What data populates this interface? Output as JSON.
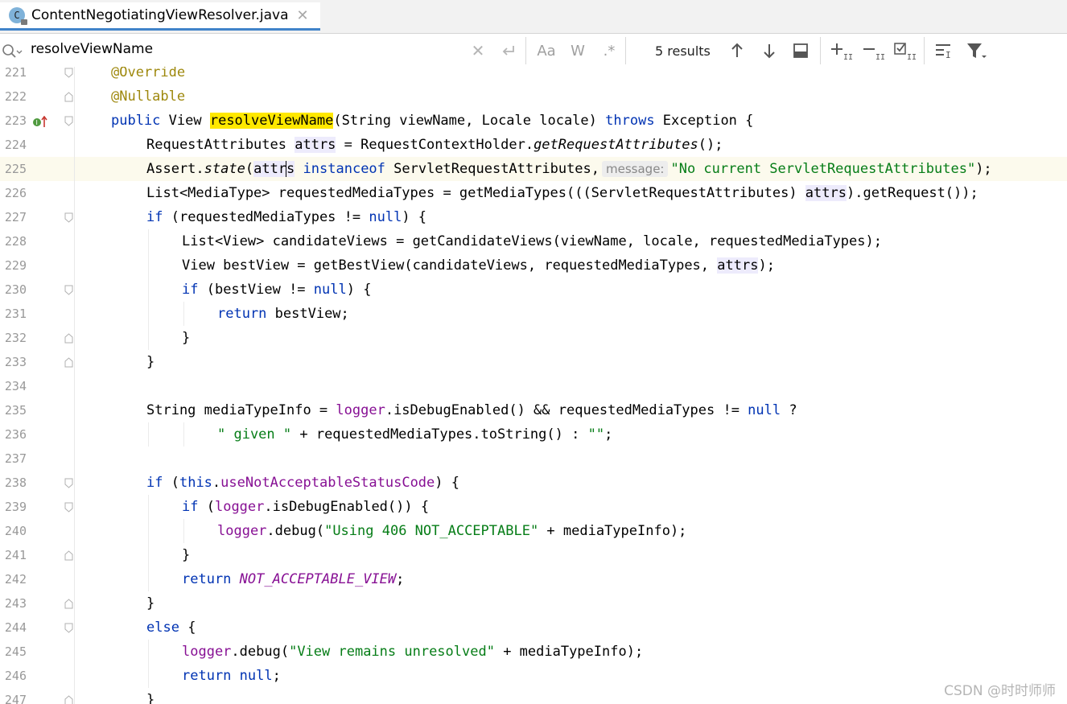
{
  "editor_tab": {
    "icon_letter": "C",
    "file_name": "ContentNegotiatingViewResolver.java",
    "close_glyph": "✕"
  },
  "search": {
    "query": "resolveViewName",
    "results_label": "5 results"
  },
  "toolbar": {
    "match_case_label": "Aa",
    "whole_words_label": "W",
    "regex_label": ".*"
  },
  "lines": [
    {
      "num": "221",
      "indent": 0,
      "tokens": [
        {
          "t": "@Override",
          "c": "ann"
        }
      ]
    },
    {
      "num": "222",
      "indent": 0,
      "tokens": [
        {
          "t": "@Nullable",
          "c": "ann"
        }
      ]
    },
    {
      "num": "223",
      "indent": 0,
      "tokens": [
        {
          "t": "public",
          "c": "kw"
        },
        {
          "t": " View "
        },
        {
          "t": "resolveViewName",
          "c": "match"
        },
        {
          "t": "(String viewName, Locale locale) "
        },
        {
          "t": "throws",
          "c": "kw"
        },
        {
          "t": " Exception {"
        }
      ]
    },
    {
      "num": "224",
      "indent": 1,
      "tokens": [
        {
          "t": "RequestAttributes "
        },
        {
          "t": "attrs",
          "c": "usage"
        },
        {
          "t": " = RequestContextHolder."
        },
        {
          "t": "getRequestAttributes",
          "c": "it"
        },
        {
          "t": "();"
        }
      ]
    },
    {
      "num": "225",
      "indent": 1,
      "current": true,
      "tokens": [
        {
          "t": "Assert."
        },
        {
          "t": "state",
          "c": "it"
        },
        {
          "t": "("
        },
        {
          "t": "attr",
          "c": "usage"
        },
        {
          "caret": true
        },
        {
          "t": "s",
          "c": "usage"
        },
        {
          "t": " "
        },
        {
          "t": "instanceof",
          "c": "kw"
        },
        {
          "t": " ServletRequestAttributes,"
        },
        {
          "t": "message:",
          "c": "hint"
        },
        {
          "t": "\"No current ServletRequestAttributes\"",
          "c": "str"
        },
        {
          "t": ");"
        }
      ]
    },
    {
      "num": "226",
      "indent": 1,
      "tokens": [
        {
          "t": "List<MediaType> requestedMediaTypes = getMediaTypes(((ServletRequestAttributes) "
        },
        {
          "t": "attrs",
          "c": "usage"
        },
        {
          "t": ").getRequest());"
        }
      ]
    },
    {
      "num": "227",
      "indent": 1,
      "tokens": [
        {
          "t": "if",
          "c": "kw"
        },
        {
          "t": " (requestedMediaTypes != "
        },
        {
          "t": "null",
          "c": "kw"
        },
        {
          "t": ") {"
        }
      ]
    },
    {
      "num": "228",
      "indent": 2,
      "tokens": [
        {
          "t": "List<View> candidateViews = getCandidateViews(viewName, locale, requestedMediaTypes);"
        }
      ]
    },
    {
      "num": "229",
      "indent": 2,
      "tokens": [
        {
          "t": "View bestView = getBestView(candidateViews, requestedMediaTypes, "
        },
        {
          "t": "attrs",
          "c": "usage"
        },
        {
          "t": ");"
        }
      ]
    },
    {
      "num": "230",
      "indent": 2,
      "tokens": [
        {
          "t": "if",
          "c": "kw"
        },
        {
          "t": " (bestView != "
        },
        {
          "t": "null",
          "c": "kw"
        },
        {
          "t": ") {"
        }
      ]
    },
    {
      "num": "231",
      "indent": 3,
      "tokens": [
        {
          "t": "return",
          "c": "kw"
        },
        {
          "t": " bestView;"
        }
      ]
    },
    {
      "num": "232",
      "indent": 2,
      "tokens": [
        {
          "t": "}"
        }
      ]
    },
    {
      "num": "233",
      "indent": 1,
      "tokens": [
        {
          "t": "}"
        }
      ]
    },
    {
      "num": "234",
      "indent": 0,
      "tokens": []
    },
    {
      "num": "235",
      "indent": 1,
      "tokens": [
        {
          "t": "String mediaTypeInfo = "
        },
        {
          "t": "logger",
          "c": "fld"
        },
        {
          "t": ".isDebugEnabled() && requestedMediaTypes != "
        },
        {
          "t": "null",
          "c": "kw"
        },
        {
          "t": " ?"
        }
      ]
    },
    {
      "num": "236",
      "indent": 3,
      "tokens": [
        {
          "t": "\" given \"",
          "c": "str"
        },
        {
          "t": " + requestedMediaTypes.toString() : "
        },
        {
          "t": "\"\"",
          "c": "str"
        },
        {
          "t": ";"
        }
      ]
    },
    {
      "num": "237",
      "indent": 0,
      "tokens": []
    },
    {
      "num": "238",
      "indent": 1,
      "tokens": [
        {
          "t": "if",
          "c": "kw"
        },
        {
          "t": " ("
        },
        {
          "t": "this",
          "c": "kw"
        },
        {
          "t": "."
        },
        {
          "t": "useNotAcceptableStatusCode",
          "c": "fld"
        },
        {
          "t": ") {"
        }
      ]
    },
    {
      "num": "239",
      "indent": 2,
      "tokens": [
        {
          "t": "if",
          "c": "kw"
        },
        {
          "t": " ("
        },
        {
          "t": "logger",
          "c": "fld"
        },
        {
          "t": ".isDebugEnabled()) {"
        }
      ]
    },
    {
      "num": "240",
      "indent": 3,
      "tokens": [
        {
          "t": "logger",
          "c": "fld"
        },
        {
          "t": ".debug("
        },
        {
          "t": "\"Using 406 NOT_ACCEPTABLE\"",
          "c": "str"
        },
        {
          "t": " + mediaTypeInfo);"
        }
      ]
    },
    {
      "num": "241",
      "indent": 2,
      "tokens": [
        {
          "t": "}"
        }
      ]
    },
    {
      "num": "242",
      "indent": 2,
      "tokens": [
        {
          "t": "return",
          "c": "kw"
        },
        {
          "t": " "
        },
        {
          "t": "NOT_ACCEPTABLE_VIEW",
          "c": "fld it"
        },
        {
          "t": ";"
        }
      ]
    },
    {
      "num": "243",
      "indent": 1,
      "tokens": [
        {
          "t": "}"
        }
      ]
    },
    {
      "num": "244",
      "indent": 1,
      "tokens": [
        {
          "t": "else",
          "c": "kw"
        },
        {
          "t": " {"
        }
      ]
    },
    {
      "num": "245",
      "indent": 2,
      "tokens": [
        {
          "t": "logger",
          "c": "fld"
        },
        {
          "t": ".debug("
        },
        {
          "t": "\"View remains unresolved\"",
          "c": "str"
        },
        {
          "t": " + mediaTypeInfo);"
        }
      ]
    },
    {
      "num": "246",
      "indent": 2,
      "tokens": [
        {
          "t": "return",
          "c": "kw"
        },
        {
          "t": " "
        },
        {
          "t": "null",
          "c": "kw"
        },
        {
          "t": ";"
        }
      ]
    },
    {
      "num": "247",
      "indent": 1,
      "tokens": [
        {
          "t": "}"
        }
      ]
    }
  ],
  "folds": [
    {
      "line": "221",
      "shape": "open"
    },
    {
      "line": "222",
      "shape": "end"
    },
    {
      "line": "223",
      "shape": "open"
    },
    {
      "line": "227",
      "shape": "open"
    },
    {
      "line": "230",
      "shape": "open"
    },
    {
      "line": "232",
      "shape": "end"
    },
    {
      "line": "233",
      "shape": "end"
    },
    {
      "line": "238",
      "shape": "open"
    },
    {
      "line": "239",
      "shape": "open"
    },
    {
      "line": "241",
      "shape": "end"
    },
    {
      "line": "243",
      "shape": "end"
    },
    {
      "line": "244",
      "shape": "open"
    },
    {
      "line": "247",
      "shape": "end"
    }
  ],
  "watermark": "CSDN @时时师师",
  "colors": {
    "keyword": "#0033b3",
    "annotation": "#9e880d",
    "string": "#067d17",
    "field": "#871094",
    "search_match": "#ffe800",
    "usage_highlight": "#edebfc",
    "tab_underline": "#4083c9"
  }
}
